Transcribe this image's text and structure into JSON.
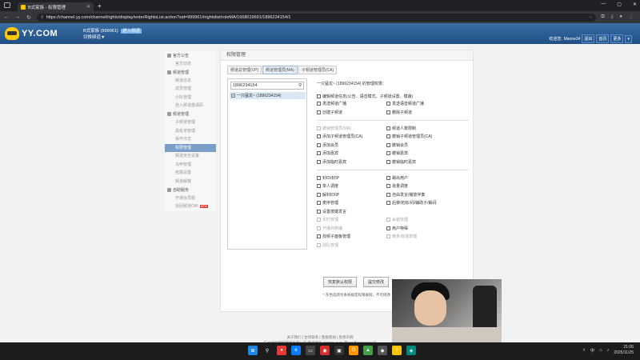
{
  "browser": {
    "tab_title": "B式家族 - 权限管理",
    "new_tab": "+",
    "url": "https://channel.yy.com/channel/rights/display/enterRightsList.action?sid=999961#rightslist/roleMA/1668019691/1896234154/1",
    "window_controls": [
      "—",
      "▢",
      "✕"
    ]
  },
  "header": {
    "logo_text": "YY.COM",
    "channel_name": "B式家族 (999961)",
    "channel_badge": "进入频道",
    "switch_channel": "切换频道▼",
    "welcome": "欢迎您,",
    "username": "Maone34",
    "logout": "退出",
    "home": "首页",
    "more": "更多"
  },
  "sidebar": {
    "groups": [
      {
        "label": "官方公告",
        "items": [
          "官方动态"
        ]
      },
      {
        "label": "频道管理",
        "items": [
          "频道信息",
          "成员管理",
          "小队管理",
          "挂入频道邀请码"
        ]
      },
      {
        "label": "频道管理",
        "items": [
          "子频道管理",
          "黑名单管理",
          "操作日志",
          "权限管理",
          "频道安全设置",
          "马甲管理",
          "拓展设置",
          "频道解散"
        ]
      },
      {
        "label": "自助服务",
        "items": [
          "开通会员服",
          "找回频道OW"
        ]
      }
    ],
    "active_item": "权限管理",
    "new_badge": "NEW"
  },
  "content": {
    "title": "权限管理",
    "subtabs": [
      "频道总管理(VP)",
      "频道管理员(MA)",
      "子频道管理员(CA)"
    ],
    "active_subtab": "频道管理员(MA)",
    "search_value": "1896234154",
    "tree_item": "一只猛龙~ (1896234154)",
    "perm_header": "一只猛龙~ (1896234154) 的管理权限：",
    "section1": {
      "full": "编辑频道信息(公告、语音模式、子频道设置、模版)",
      "grid": [
        {
          "label": "发送频道广播",
          "disabled": false
        },
        {
          "label": "发送语音频道广播",
          "disabled": false
        },
        {
          "label": "创建子频道",
          "disabled": false
        },
        {
          "label": "删除子频道",
          "disabled": false
        }
      ]
    },
    "section2": [
      {
        "label": "撤销管理员(MA)",
        "disabled": true
      },
      {
        "label": "频道人数限制",
        "disabled": false
      },
      {
        "label": "添加子频道管理员(CA)",
        "disabled": false
      },
      {
        "label": "撤销子频道管理员(CA)",
        "disabled": false
      },
      {
        "label": "添加会员",
        "disabled": false
      },
      {
        "label": "撤销会员",
        "disabled": false
      },
      {
        "label": "添加嘉宾",
        "disabled": false
      },
      {
        "label": "撤销嘉宾",
        "disabled": false
      },
      {
        "label": "添加临时嘉宾",
        "disabled": false
      },
      {
        "label": "撤销临时嘉宾",
        "disabled": false
      }
    ],
    "section3": [
      {
        "label": "封ID/封IP",
        "disabled": false
      },
      {
        "label": "踢出用户",
        "disabled": false
      },
      {
        "label": "单人调度",
        "disabled": false
      },
      {
        "label": "批量调度",
        "disabled": false
      },
      {
        "label": "解封ID/IP",
        "disabled": false
      },
      {
        "label": "自由发言/播放伴奏",
        "disabled": false
      },
      {
        "label": "麦序管理",
        "disabled": false
      },
      {
        "label": "后禁/抢标/闷/辅助子/解闷",
        "disabled": false
      },
      {
        "label": "设置按键发言",
        "disabled": false
      },
      {
        "label": "",
        "disabled": false
      },
      {
        "label": "实时管理",
        "disabled": true
      },
      {
        "label": "采蜡管理",
        "disabled": true
      },
      {
        "label": "开播列表编",
        "disabled": true
      },
      {
        "label": "用户特殊",
        "disabled": false
      },
      {
        "label": "找频子面板管理",
        "disabled": false
      },
      {
        "label": "黄条/标题管理",
        "disabled": true
      },
      {
        "label": "战队管理",
        "disabled": true
      },
      {
        "label": "",
        "disabled": false
      }
    ],
    "btn_restore": "恢复默认权限",
    "btn_submit": "提交修改",
    "note": "* 灰色选项为系统规定权限规则，不可修改"
  },
  "footer": {
    "links": "关于我们 | 合作联系 | 客服帮助 | 免责声明",
    "copyright": "广州津虹网络传媒有限公司 版权所有 ©2008-2025 粤ICP备10011574号"
  },
  "taskbar": {
    "time": "21:06",
    "date": "2025/11/25",
    "lang": "中"
  }
}
